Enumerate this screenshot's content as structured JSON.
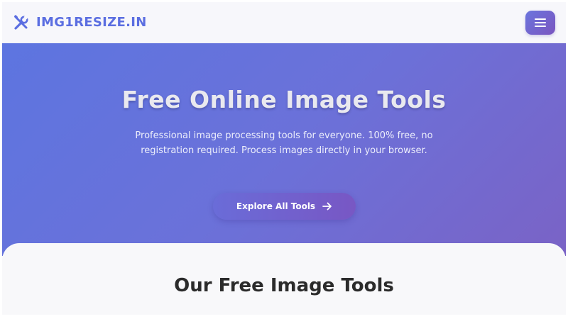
{
  "header": {
    "logo_text": "IMG1RESIZE.IN",
    "logo_icon": "tools-icon",
    "menu_icon": "hamburger-menu-icon"
  },
  "hero": {
    "title": "Free Online Image Tools",
    "subtitle": "Professional image processing tools for everyone. 100% free, no registration required. Process images directly in your browser.",
    "cta_label": "Explore All Tools",
    "cta_icon": "arrow-right-icon"
  },
  "tools_section": {
    "title": "Our Free Image Tools"
  },
  "colors": {
    "brand": "#5b6ee1",
    "hero_start": "#5d75e0",
    "hero_end": "#7a63c6",
    "button_start": "#6a6cd8",
    "button_end": "#7857c4",
    "heading_text": "#2b2b2b"
  }
}
